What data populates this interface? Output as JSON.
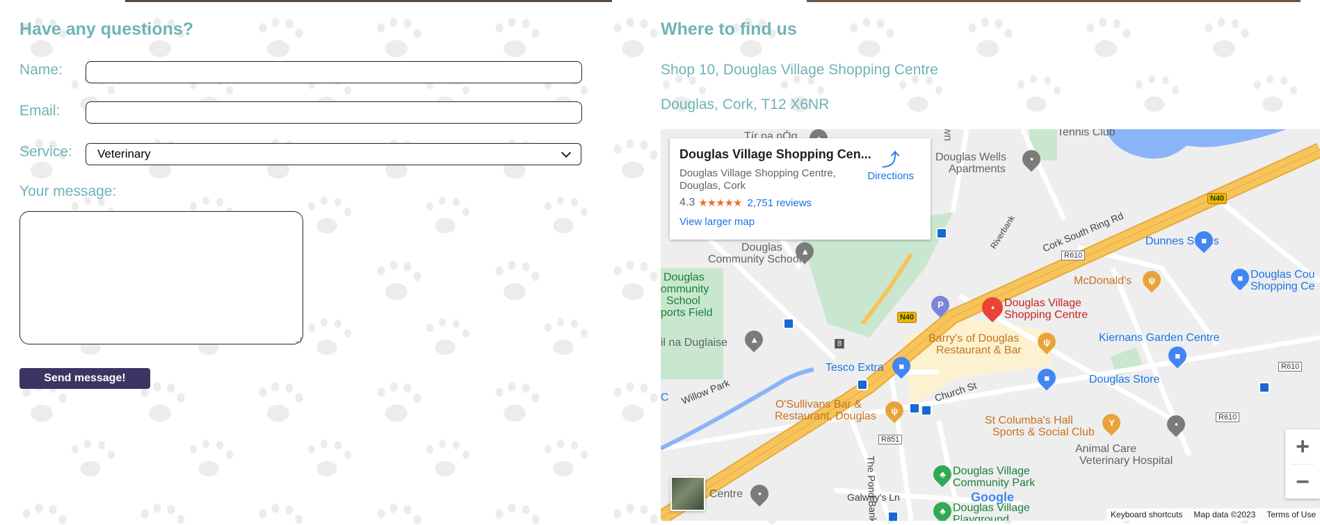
{
  "contact": {
    "heading": "Have any questions?",
    "name_label": "Name:",
    "name_value": "",
    "email_label": "Email:",
    "email_value": "",
    "service_label": "Service:",
    "service_selected": "Veterinary",
    "message_label": "Your message:",
    "message_value": "",
    "send_label": "Send message!"
  },
  "location": {
    "heading": "Where to find us",
    "address_line1": "Shop 10, Douglas Village Shopping Centre",
    "address_line2": "Douglas, Cork, T12 X6NR"
  },
  "map": {
    "card": {
      "title": "Douglas Village Shopping Cen...",
      "address_line1": "Douglas Village Shopping Centre,",
      "address_line2": "Douglas, Cork",
      "rating": "4.3",
      "stars": "★★★★★",
      "rating_value": 4.3,
      "reviews": "2,751 reviews",
      "larger_map": "View larger map",
      "directions": "Directions"
    },
    "labels": {
      "tir_na_nog": "Tír na nÓg",
      "tennis_club": "Tennis Club",
      "wells_apartments_1": "Douglas Wells",
      "wells_apartments_2": "Apartments",
      "community_school_1": "Douglas",
      "community_school_2": "Community School",
      "school_field_1": "Douglas",
      "school_field_2": "ommunity",
      "school_field_3": "School",
      "school_field_4": "ports Field",
      "dunnes": "Dunnes Stores",
      "mcdonalds": "McDonald's",
      "douglas_court_1": "Douglas Cou",
      "douglas_court_2": "Shopping Ce",
      "dvsc_1": "Douglas Village",
      "dvsc_2": "Shopping Centre",
      "barrys_1": "Barry's of Douglas",
      "barrys_2": "Restaurant & Bar",
      "kiernans": "Kiernans Garden Centre",
      "nadouglaise": "il na Duglaise",
      "tesco": "Tesco Extra",
      "douglas_store": "Douglas Store",
      "willow_park": "Willow Park",
      "church_st": "Church St",
      "osullivans_1": "O'Sullivans Bar &",
      "osullivans_2": "Restaurant, Douglas",
      "st_columbas_1": "St Columba's Hall",
      "st_columbas_2": "Sports & Social Club",
      "animal_care_1": "Animal Care",
      "animal_care_2": "Veterinary Hospital",
      "pond_bank": "The Pond Bank",
      "community_park_1": "Douglas Village",
      "community_park_2": "Community Park",
      "playground_1": "Douglas Village",
      "playground_2": "Playground",
      "centre": "Centre",
      "galways_ln": "Galway's Ln",
      "ring_rd": "Cork South Ring Rd",
      "riverbank": "Riverbank",
      "dawn": "awn",
      "c": "C"
    },
    "shields": {
      "n40_a": "N40",
      "n40_b": "N40",
      "r610_a": "R610",
      "r610_b": "R610",
      "r610_c": "R610",
      "r851": "R851",
      "eight": "8"
    },
    "google": "Google",
    "attribution": {
      "shortcuts": "Keyboard shortcuts",
      "data": "Map data ©2023",
      "terms": "Terms of Use"
    },
    "zoom_in": "+",
    "zoom_out": "−"
  },
  "colors": {
    "accent_teal": "#6fb3b6",
    "button_bg": "#3b3563",
    "map_link_blue": "#1a73e8",
    "highway_yellow": "#f6c45a",
    "water_blue": "#8ab4f8",
    "park_green": "#c9e7cf"
  },
  "icons": {
    "directions": "directions-icon",
    "pin": "map-pin-icon",
    "restaurant": "restaurant-icon",
    "shopping": "shopping-bag-icon",
    "school": "school-icon",
    "bus": "bus-icon",
    "parking": "parking-icon",
    "park": "park-tree-icon"
  }
}
